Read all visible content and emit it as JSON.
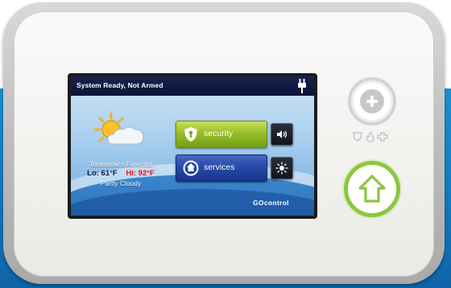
{
  "screen": {
    "status": "System Ready, Not Armed",
    "forecast": {
      "title": "Tomorrow's Forecast",
      "lo": "Lo: 61°F",
      "hi": "Hi: 92°F",
      "conditions": "Partly Cloudy"
    },
    "buttons": {
      "security_label": "security",
      "services_label": "services"
    },
    "brand": "GOcontrol",
    "icons": [
      "power-plug-icon",
      "partly-cloudy-icon",
      "shield-icon",
      "services-icon",
      "volume-icon",
      "brightness-icon"
    ]
  },
  "hardware": {
    "icons": [
      "plus-icon",
      "police-icon",
      "fire-icon",
      "medical-cross-icon",
      "home-icon"
    ]
  },
  "colors": {
    "header": "#0c1438",
    "security_button": "#98bd2c",
    "services_button": "#284aa6",
    "hi_temp": "#e0171d",
    "home_ring": "#8cc63f",
    "backdrop": "#1478bd"
  }
}
